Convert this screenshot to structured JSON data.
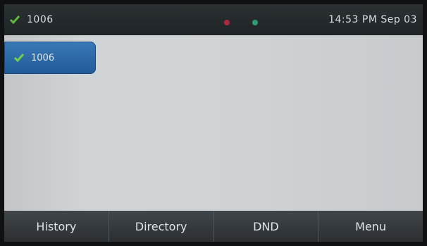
{
  "status_bar": {
    "account_label": "1006",
    "datetime": "14:53 PM Sep 03"
  },
  "line_key": {
    "label": "1006"
  },
  "softkeys": [
    {
      "label": "History"
    },
    {
      "label": "Directory"
    },
    {
      "label": "DND"
    },
    {
      "label": "Menu"
    }
  ],
  "colors": {
    "status_bar": "#252a2d",
    "line_key": "#2e6aa8",
    "registered_check": "#5dbb3a",
    "softkey_bar": "#363b3e"
  },
  "icons": {
    "account": "check-icon",
    "line_key": "check-icon"
  }
}
